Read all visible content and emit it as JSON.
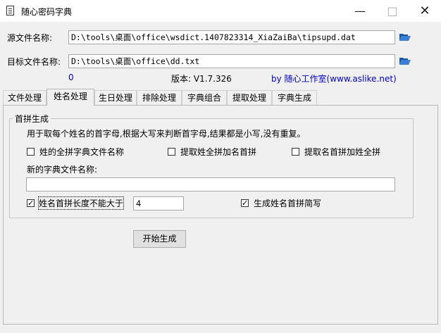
{
  "window": {
    "title": "随心密码字典"
  },
  "source": {
    "label": "源文件名称:",
    "value": "D:\\tools\\桌面\\office\\wsdict.1407823314_XiaZaiBa\\tipsupd.dat"
  },
  "target": {
    "label": "目标文件名称:",
    "value": "D:\\tools\\桌面\\office\\dd.txt"
  },
  "status": {
    "count": "0",
    "version": "版本: V1.7.326",
    "credit": "by 随心工作室(www.aslike.net)"
  },
  "tabs": [
    "文件处理",
    "姓名处理",
    "生日处理",
    "排除处理",
    "字典组合",
    "提取处理",
    "字典生成"
  ],
  "group": {
    "title": "首拼生成",
    "description": "用于取每个姓名的首字母,根据大写来判断首字母,结果都是小写,没有重复。",
    "opt1": "姓的全拼字典文件名称",
    "opt2": "提取姓全拼加名首拼",
    "opt3": "提取名首拼加姓全拼",
    "new_file_label": "新的字典文件名称:",
    "new_file_value": "",
    "limit_label": "姓名首拼长度不能大于",
    "limit_value": "4",
    "short_label": "生成姓名首拼简写"
  },
  "start_button": "开始生成",
  "colors": {
    "accent_text": "#0000cc"
  }
}
